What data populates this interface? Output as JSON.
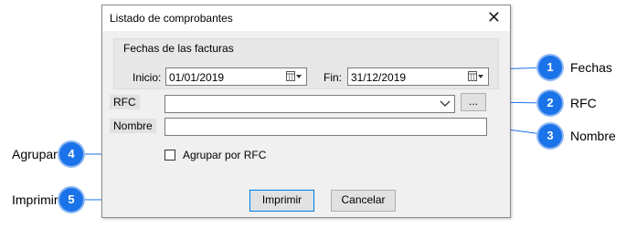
{
  "dialog": {
    "title": "Listado de comprobantes",
    "close_glyph": "✕"
  },
  "dates_group": {
    "title": "Fechas de las facturas",
    "start_label": "Inicio:",
    "start_value": "01/01/2019",
    "end_label": "Fin:",
    "end_value": "31/12/2019"
  },
  "rfc": {
    "label": "RFC",
    "value": "",
    "browse_label": "..."
  },
  "nombre": {
    "label": "Nombre",
    "value": ""
  },
  "group_by": {
    "label": "Agrupar por RFC",
    "checked": false
  },
  "buttons": {
    "print": "Imprimir",
    "cancel": "Cancelar"
  },
  "callouts": [
    {
      "number": "1",
      "text": "Fechas"
    },
    {
      "number": "2",
      "text": "RFC"
    },
    {
      "number": "3",
      "text": "Nombre"
    },
    {
      "number": "4",
      "text": "Agrupar"
    },
    {
      "number": "5",
      "text": "Imprimir"
    }
  ],
  "colors": {
    "badge": "#1a73e8",
    "primary_border": "#0078d7"
  }
}
